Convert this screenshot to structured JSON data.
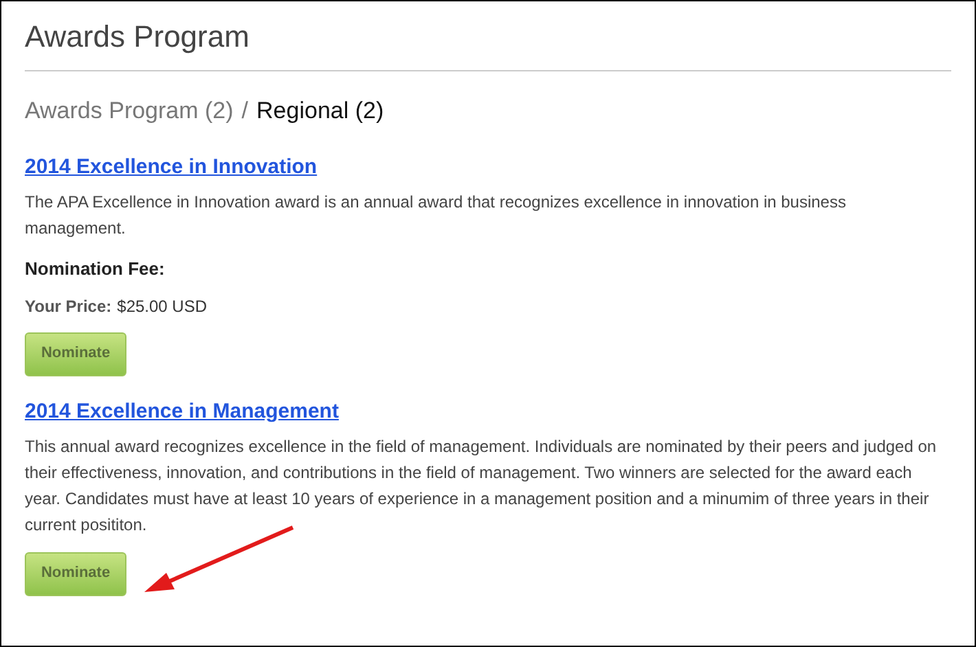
{
  "page_title": "Awards Program",
  "breadcrumb": [
    {
      "label": "Awards Program (2)",
      "selected": false
    },
    {
      "label": "Regional (2)",
      "selected": true
    }
  ],
  "breadcrumb_separator": "/",
  "awards": [
    {
      "title": "2014 Excellence in Innovation",
      "description": "The APA Excellence in Innovation award is an annual award that recognizes excellence in innovation in business management.",
      "fee_heading": "Nomination Fee:",
      "price_label": "Your Price:",
      "price_value": "$25.00 USD",
      "button": "Nominate"
    },
    {
      "title": "2014 Excellence in Management",
      "description": "This annual award recognizes excellence in the field of management. Individuals are nominated by their peers and judged on their effectiveness, innovation, and contributions in the field of management. Two winners are selected for the award each year. Candidates must have at least 10 years of experience in a management position and a minumim of three years in their current posititon.",
      "button": "Nominate"
    }
  ]
}
